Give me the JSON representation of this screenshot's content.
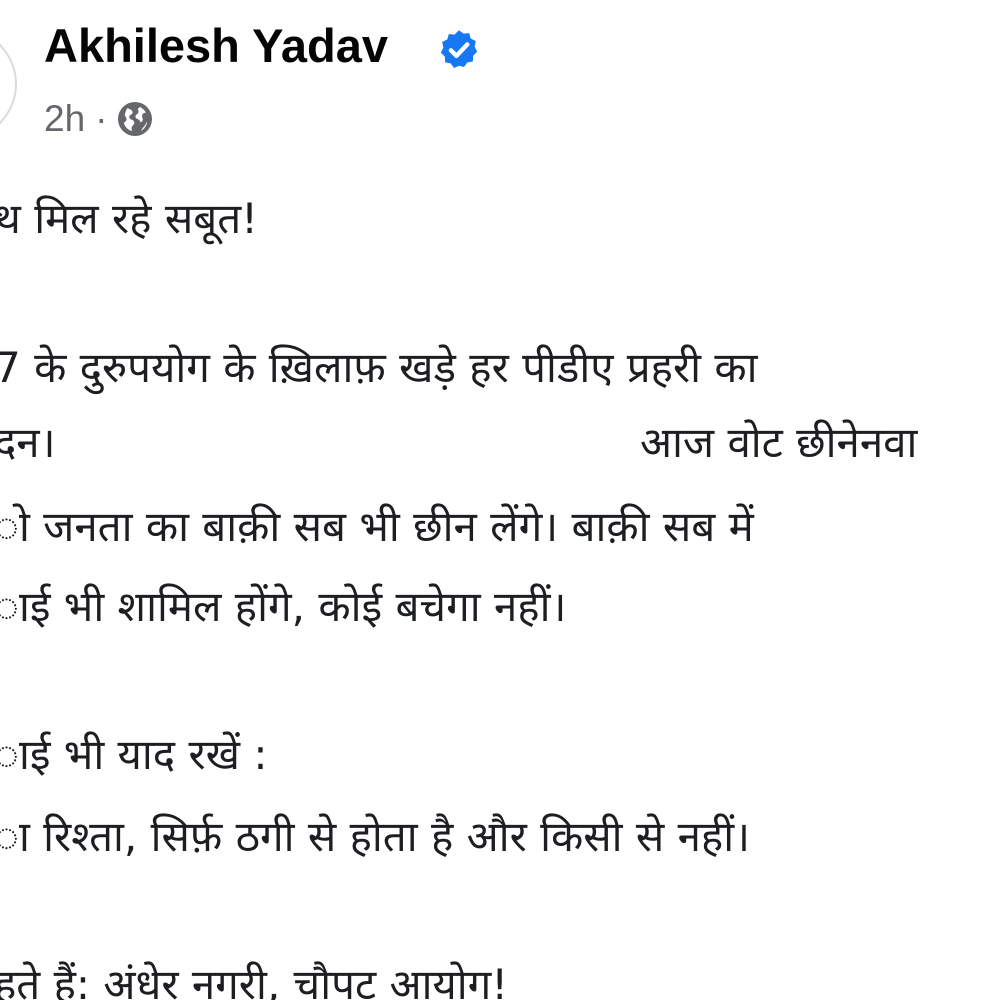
{
  "post": {
    "author": "Akhilesh Yadav",
    "timestamp": "2h",
    "separator": "·",
    "audience_icon": "globe-icon",
    "verified_icon": "verified-badge-icon",
    "colors": {
      "verified": "#1877f2",
      "meta": "#65676b",
      "text": "#1c1e21"
    },
    "body": {
      "line1": "थ मिल रहे सबूत!",
      "line2": "7 के दुरुपयोग के ख़िलाफ़ खड़े हर पीडीए प्रहरी का",
      "line3a": "दन।",
      "line3b": "आज वोट छीनेनवा",
      "line4": "ो जनता का बाक़ी सब भी छीन लेंगे। बाक़ी सब में",
      "line5": "ाई भी शामिल होंगे, कोई बचेगा नहीं।",
      "line6": "ाई भी याद रखें :",
      "line7": "ा रिश्ता, सिर्फ़ ठगी से होता है और किसी से नहीं।",
      "line8": "हते हैं: अंधेर नगरी, चौपट आयोग!"
    }
  }
}
